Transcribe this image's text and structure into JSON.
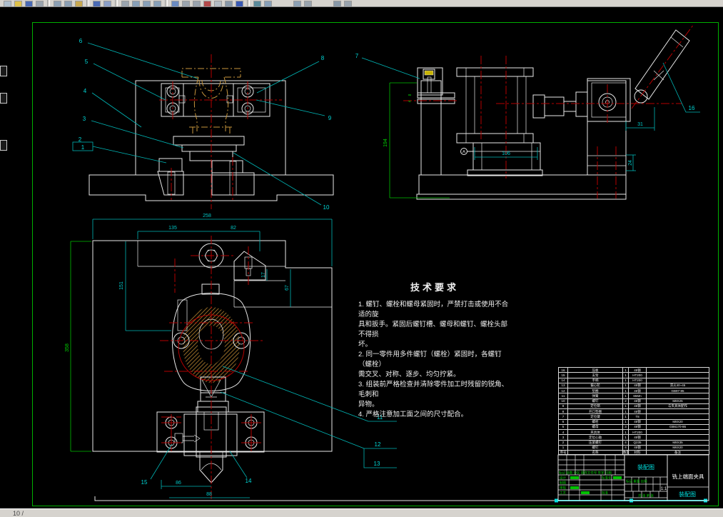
{
  "toolbar": {
    "items": [
      {
        "kind": "icon",
        "name": "new-icon",
        "color": "#aebecd"
      },
      {
        "kind": "icon",
        "name": "open-icon",
        "color": "#e0c24a"
      },
      {
        "kind": "icon",
        "name": "save-icon",
        "color": "#4a6ab4"
      },
      {
        "kind": "icon",
        "name": "plot-icon",
        "color": "#9aa4ae"
      },
      {
        "kind": "sep"
      },
      {
        "kind": "icon",
        "name": "cut-icon",
        "color": "#8ca0b4"
      },
      {
        "kind": "icon",
        "name": "copy-icon",
        "color": "#8ca0b4"
      },
      {
        "kind": "icon",
        "name": "paste-icon",
        "color": "#c8a850"
      },
      {
        "kind": "sep"
      },
      {
        "kind": "icon",
        "name": "undo-icon",
        "color": "#4a6ab4"
      },
      {
        "kind": "icon",
        "name": "redo-icon",
        "color": "#8ca0c8"
      },
      {
        "kind": "sep"
      },
      {
        "kind": "icon",
        "name": "pan-icon",
        "color": "#9aa4ae"
      },
      {
        "kind": "icon",
        "name": "zoom-realtime-icon",
        "color": "#88a0b8"
      },
      {
        "kind": "icon",
        "name": "zoom-window-icon",
        "color": "#88a0b8"
      },
      {
        "kind": "icon",
        "name": "zoom-previous-icon",
        "color": "#88a0b8"
      },
      {
        "kind": "sep"
      },
      {
        "kind": "icon",
        "name": "find-icon",
        "color": "#6a8ac0"
      },
      {
        "kind": "icon",
        "name": "text-style-icon",
        "color": "#9aa4ae"
      },
      {
        "kind": "icon",
        "name": "table-icon",
        "color": "#9aa4ae"
      },
      {
        "kind": "icon",
        "name": "layer-icon",
        "color": "#b44a4a"
      },
      {
        "kind": "icon",
        "name": "print-preview-icon",
        "color": "#b4bcc4"
      },
      {
        "kind": "icon",
        "name": "calculator-icon",
        "color": "#8898a8"
      },
      {
        "kind": "icon",
        "name": "help-icon",
        "color": "#3a5ab4"
      },
      {
        "kind": "sep"
      },
      {
        "kind": "icon",
        "name": "3dorbit-icon",
        "color": "#5a8a9a"
      },
      {
        "kind": "icon",
        "name": "shade-icon",
        "color": "#88a0b8"
      },
      {
        "kind": "spacer"
      },
      {
        "kind": "icon",
        "name": "sheetset-icon",
        "color": "#8ca0b4"
      },
      {
        "kind": "icon",
        "name": "markup-icon",
        "color": "#9aa4ae"
      },
      {
        "kind": "spacer"
      },
      {
        "kind": "icon",
        "name": "block-icon",
        "color": "#8898a8"
      },
      {
        "kind": "icon",
        "name": "properties-icon",
        "color": "#9aa4ae"
      }
    ]
  },
  "callouts": {
    "c1": "1",
    "c2": "2",
    "c3": "3",
    "c4": "4",
    "c5": "5",
    "c6": "6",
    "c7": "7",
    "c8": "8",
    "c9": "9",
    "c10": "10",
    "c11": "11",
    "c12": "12",
    "c13": "13",
    "c14": "14",
    "c15": "15",
    "c16": "16"
  },
  "dims": {
    "plan_width": "258",
    "plan_seg1": "135",
    "plan_seg2": "82",
    "plan_height": "358",
    "plan_mid": "151",
    "plan_s17": "17",
    "plan_s67": "67",
    "plan_b86": "86",
    "plan_b88": "88",
    "side_h": "194",
    "side_base": "106",
    "side_31": "31",
    "side_24": "24",
    "side_g8": "8",
    "side_g4": "4",
    "datum": "A"
  },
  "tech": {
    "title": "技术要求",
    "lines": [
      "1. 螺钉、螺栓和螺母紧固时，严禁打击或使用不合适的旋",
      "具和扳手。紧固后螺钉槽、螺母和螺钉、螺栓头部不得损",
      "坏。",
      "2. 同一零件用多件螺钉（螺栓）紧固时，各螺钉（螺栓）",
      "需交叉、对称、逐步、均匀拧紧。",
      "3. 组装前严格检查并清除零件加工时残留的锐角、毛刺和",
      "异物。",
      "4. 严格注意加工面之间的尺寸配合。"
    ]
  },
  "bom": {
    "headers": [
      "序号",
      "名称",
      "数量",
      "材料",
      "备注"
    ],
    "rows": [
      [
        "16",
        "压板",
        "1",
        "45钢",
        ""
      ],
      [
        "15",
        "支架",
        "1",
        "HT200",
        ""
      ],
      [
        "14",
        "手柄",
        "1",
        "HT200",
        ""
      ],
      [
        "13",
        "偏心轮",
        "1",
        "45钢",
        "淬火40~45"
      ],
      [
        "12",
        "垫圈",
        "1",
        "45钢",
        "GB97-85"
      ],
      [
        "11",
        "弹簧",
        "1",
        "65Mn",
        ""
      ],
      [
        "10",
        "螺钉",
        "2",
        "45钢",
        "M8X25"
      ],
      [
        "9",
        "定位销",
        "1",
        "45钢",
        "与夹具体配作"
      ],
      [
        "8",
        "开口垫圈",
        "1",
        "45钢",
        ""
      ],
      [
        "7",
        "定位键",
        "1",
        "T8",
        ""
      ],
      [
        "6",
        "螺栓",
        "1",
        "45钢",
        "M8X20"
      ],
      [
        "5",
        "螺母",
        "3",
        "45钢",
        "GB6170-86"
      ],
      [
        "4",
        "夹具体",
        "1",
        "HT200",
        ""
      ],
      [
        "3",
        "定位心轴",
        "1",
        "45钢",
        ""
      ],
      [
        "2",
        "压紧螺钉",
        "4",
        "Q235",
        "M8X35"
      ],
      [
        "1",
        "螺钉",
        "4",
        "45钢",
        "M6X20"
      ]
    ]
  },
  "titleblock": {
    "type_label": "装配图",
    "product": "铣上端面夹具",
    "sheet": "装配图",
    "scale": "1:1",
    "rev_header": "标记 处数 分区 更改文件号 签字 日期",
    "sig1": "设计",
    "sig2": "制图",
    "sig3": "审核",
    "sig4": "工艺",
    "std": "标准化",
    "appr": "批准",
    "info": "标记 重量 比例",
    "sheets": "共 张 第 张"
  },
  "statusbar": {
    "left_text": "10 /"
  }
}
